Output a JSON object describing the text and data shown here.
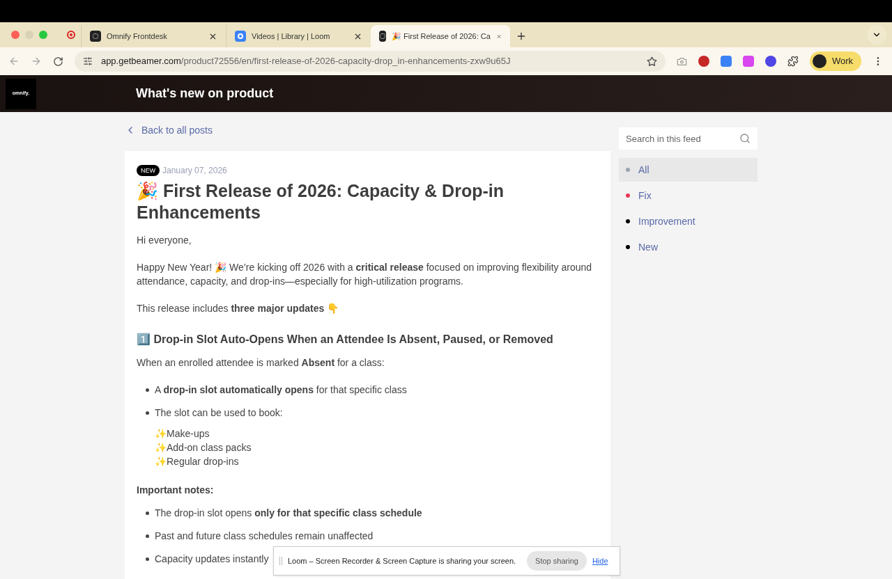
{
  "browser": {
    "tabs": [
      {
        "title": "Omnify Frontdesk",
        "selected": false
      },
      {
        "title": "Videos | Library | Loom",
        "selected": false
      },
      {
        "title": "🎉 First Release of 2026: Ca",
        "selected": true
      }
    ],
    "url_host": "app.getbeamer.com",
    "url_path": "/product72556/en/first-release-of-2026-capacity-drop_in-enhancements-zxw9u65J",
    "profile": "Work"
  },
  "header": {
    "logo": "omnify.",
    "title": "What's new on product"
  },
  "back_link": "Back to all posts",
  "post": {
    "badge": "NEW",
    "date": "January 07, 2026",
    "title": "🎉 First Release of 2026: Capacity & Drop-in Enhancements",
    "blocks": [
      {
        "kind": "p",
        "text": "Hi everyone,"
      },
      {
        "kind": "p",
        "text": "Happy New Year! 🎉 We’re kicking off 2026 with a **critical release** focused on improving flexibility around attendance, capacity, and drop-ins—especially for high-utilization programs."
      },
      {
        "kind": "p",
        "text": "This release includes **three major updates** 👇"
      },
      {
        "kind": "h",
        "text": "1️⃣ Drop-in Slot Auto-Opens When an Attendee Is Absent, Paused, or Removed"
      },
      {
        "kind": "p",
        "text": "When an enrolled attendee is marked **Absent** for a class:"
      },
      {
        "kind": "ul",
        "items": [
          "A **drop-in slot automatically opens** for that specific class",
          "The slot can be used to book:"
        ]
      },
      {
        "kind": "lines",
        "items": [
          "✨Make-ups",
          "✨Add-on class packs",
          "✨Regular drop-ins"
        ]
      },
      {
        "kind": "label",
        "text": "Important notes:"
      },
      {
        "kind": "ul",
        "items": [
          "The drop-in slot opens **only for that specific class schedule**",
          "Past and future class schedules remain unaffected",
          "Capacity updates instantly"
        ]
      }
    ]
  },
  "sidebar": {
    "search_placeholder": "Search in this feed",
    "categories": [
      {
        "label": "All",
        "color": "#9ca3af",
        "selected": true
      },
      {
        "label": "Fix",
        "color": "#e8375a",
        "selected": false
      },
      {
        "label": "Improvement",
        "color": "#000000",
        "selected": false
      },
      {
        "label": "New",
        "color": "#000000",
        "selected": false
      }
    ]
  },
  "share_bar": {
    "message": "Loom – Screen Recorder & Screen Capture is sharing your screen.",
    "stop": "Stop sharing",
    "hide": "Hide"
  }
}
